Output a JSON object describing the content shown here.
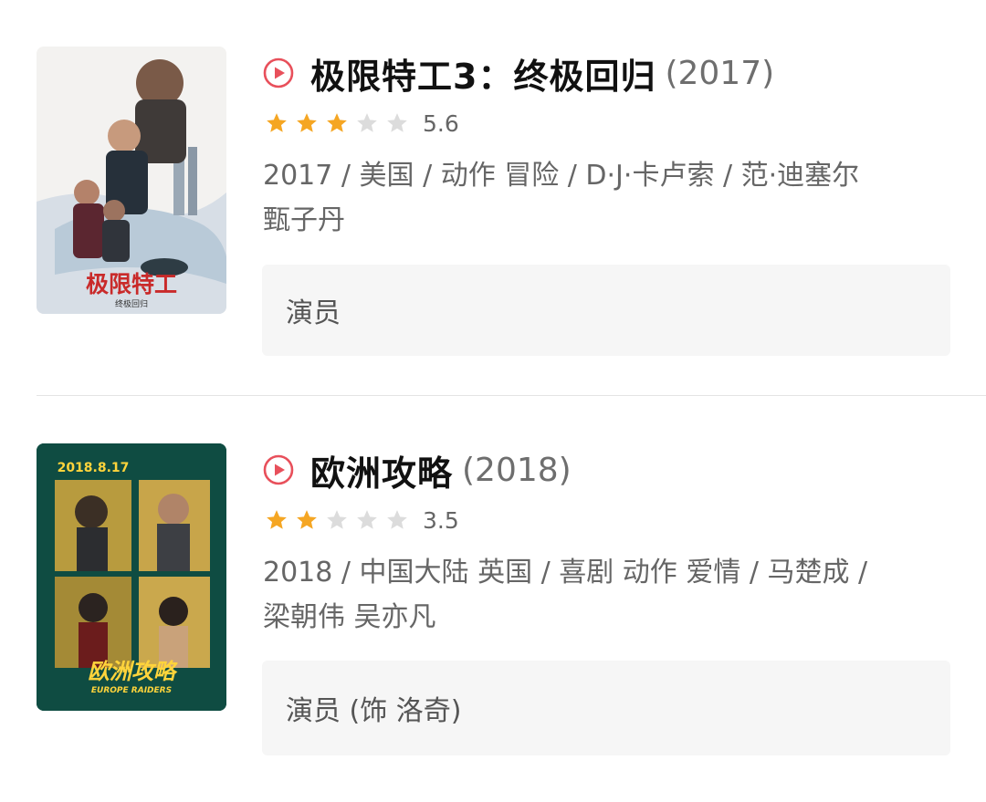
{
  "colors": {
    "accent_red": "#e8505b",
    "star_filled": "#f5a623",
    "star_empty": "#dcdcdc",
    "cast_bg": "#f6f6f6"
  },
  "movies": [
    {
      "title": "极限特工3：终极回归",
      "year": "(2017)",
      "rating": 5.6,
      "rating_text": "5.6",
      "stars_filled": 3,
      "stars_total": 5,
      "meta_line1": "2017 / 美国 / 动作 冒险 / D·J·卡卢索 / 范·迪塞尔",
      "meta_line2": "甄子丹",
      "cast": "演员",
      "poster": {
        "title_text": "极限特工",
        "subtitle_text": "终极回归"
      },
      "play_icon": "play-circle-icon"
    },
    {
      "title": "欧洲攻略",
      "year": "(2018)",
      "rating": 3.5,
      "rating_text": "3.5",
      "stars_filled": 2,
      "stars_total": 5,
      "meta_line1": "2018 / 中国大陆 英国 / 喜剧 动作 爱情 / 马楚成 /",
      "meta_line2": "梁朝伟 吴亦凡",
      "cast": "演员 (饰 洛奇)",
      "poster": {
        "date_text": "2018.8.17",
        "title_text": "欧洲攻略",
        "subtitle_text": "EUROPE RAIDERS"
      },
      "play_icon": "play-circle-icon"
    }
  ]
}
